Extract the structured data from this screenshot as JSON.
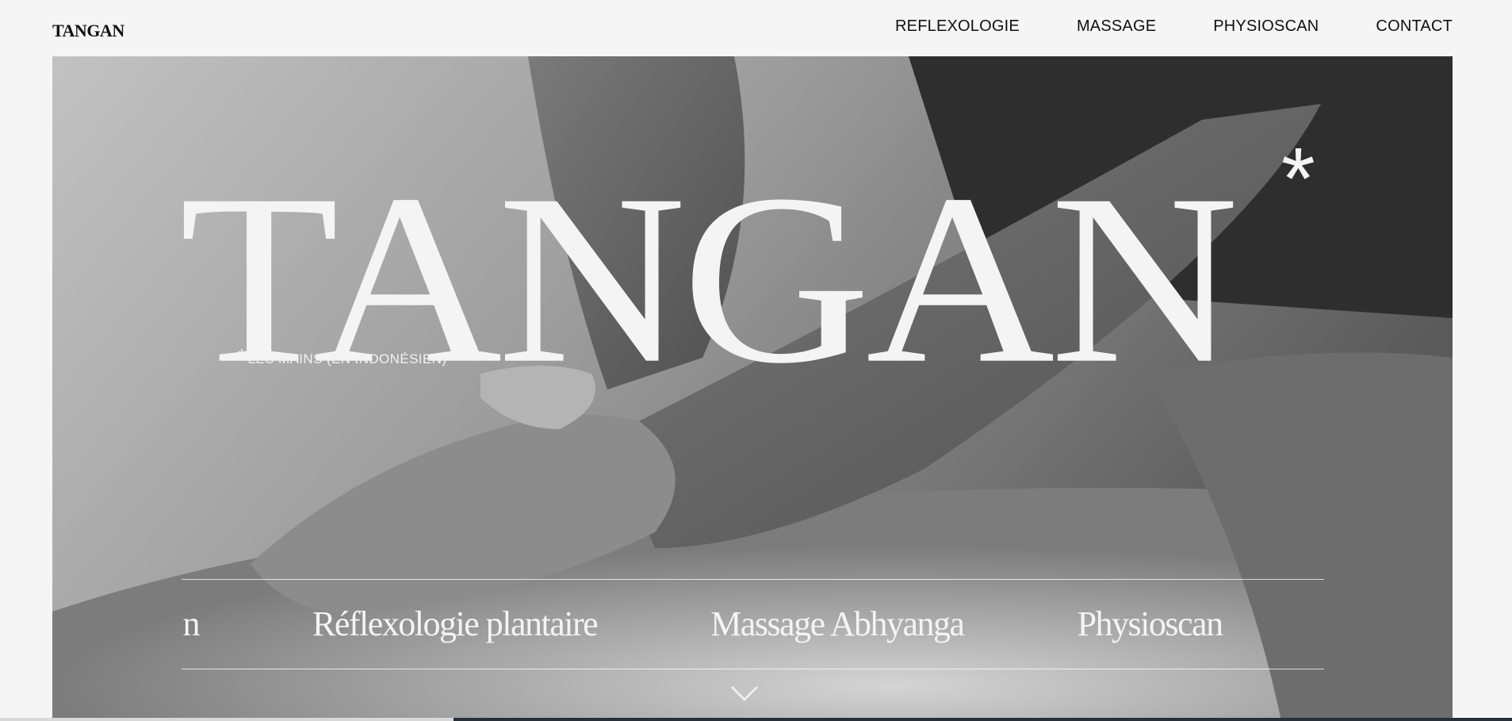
{
  "header": {
    "logo": "TANGAN",
    "nav": [
      {
        "label": "REFLEXOLOGIE"
      },
      {
        "label": "MASSAGE"
      },
      {
        "label": "PHYSIOSCAN"
      },
      {
        "label": "CONTACT"
      }
    ]
  },
  "hero": {
    "title": "TANGAN",
    "asterisk": "*",
    "subtitle_asterisk": "*",
    "subtitle": "LES MAINS (EN INDONÉSIEN)",
    "image_description": "black-and-white photo of hands massaging a back",
    "services": [
      "n",
      "Réflexologie plantaire",
      "Massage Abhyanga",
      "Physioscan"
    ],
    "scroll_icon": "chevron-down-icon"
  },
  "scroll_progress": 0.3,
  "colors": {
    "background": "#f5f5f5",
    "text_dark": "#111111",
    "text_light": "#f4f4f4",
    "bar_dark": "#263038"
  }
}
